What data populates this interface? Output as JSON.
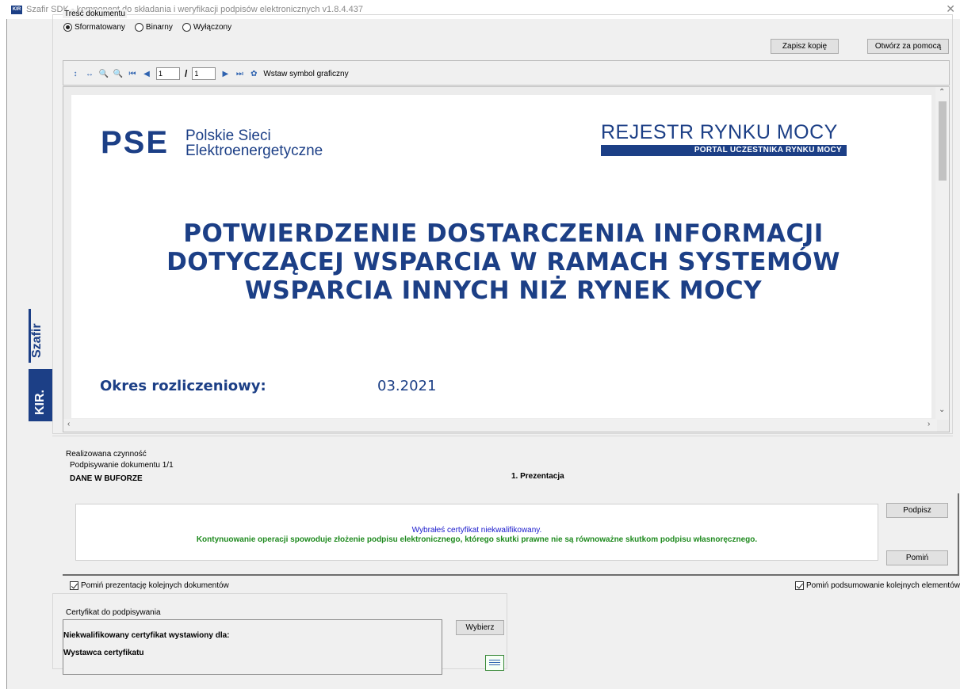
{
  "window": {
    "title": "Szafir SDK - komponent do składania i weryfikacji podpisów elektronicznych v1.8.4.437",
    "app_icon_text": "KIR"
  },
  "branding": {
    "product": "Szafir",
    "company": "KIR."
  },
  "document_content": {
    "group_label": "Treść dokumentu",
    "modes": [
      {
        "label": "Sformatowany",
        "selected": true
      },
      {
        "label": "Binarny",
        "selected": false
      },
      {
        "label": "Wyłączony",
        "selected": false
      }
    ],
    "save_copy_label": "Zapisz kopię",
    "open_with_label": "Otwórz za pomocą"
  },
  "toolbar": {
    "current_page": "1",
    "total_pages": "1",
    "insert_symbol_label": "Wstaw symbol graficzny"
  },
  "preview": {
    "pse_word": "PSE",
    "pse_line1": "Polskie Sieci",
    "pse_line2": "Elektroenergetyczne",
    "registry_title": "REJESTR RYNKU MOCY",
    "registry_subtitle": "PORTAL UCZESTNIKA RYNKU MOCY",
    "heading_line1": "POTWIERDZENIE DOSTARCZENIA INFORMACJI",
    "heading_line2": "DOTYCZĄCEJ WSPARCIA W RAMACH SYSTEMÓW",
    "heading_line3": "WSPARCIA INNYCH NIŻ RYNEK MOCY",
    "period_label": "Okres rozliczeniowy:",
    "period_value": "03.2021"
  },
  "action": {
    "group_label": "Realizowana czynność",
    "signing_progress": "Podpisywanie dokumentu 1/1",
    "buffer_label": "DANE W BUFORZE",
    "stage_label": "1. Prezentacja",
    "message_line1": "Wybrałeś certyfikat niekwalifikowany.",
    "message_line2": "Kontynuowanie operacji spowoduje złożenie podpisu elektronicznego, którego skutki prawne nie są równoważne skutkom podpisu własnoręcznego.",
    "sign_label": "Podpisz",
    "skip_label": "Pomiń",
    "skip_presentation_label": "Pomiń prezentację kolejnych dokumentów",
    "skip_presentation_checked": true,
    "skip_summary_label": "Pomiń podsumowanie kolejnych elementów",
    "skip_summary_checked": true
  },
  "certificate": {
    "group_label": "Certyfikat do podpisywania",
    "issued_for_label": "Niekwalifikowany certyfikat wystawiony dla:",
    "issuer_label": "Wystawca certyfikatu",
    "choose_label": "Wybierz"
  },
  "colors": {
    "brand_blue": "#1c3f86",
    "message_blue": "#1a1acc",
    "message_green": "#1f8a1f",
    "window_bg": "#f0f0f0"
  }
}
